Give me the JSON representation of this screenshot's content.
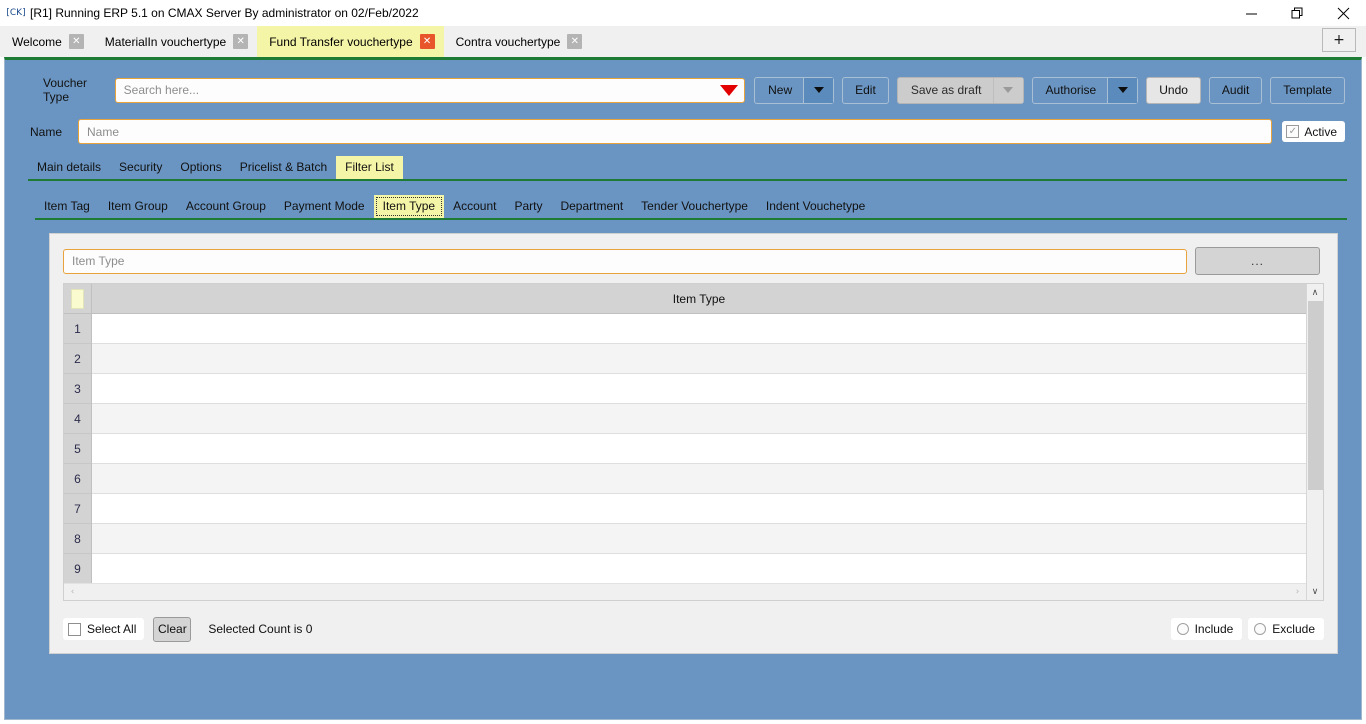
{
  "window": {
    "title": "[R1] Running ERP 5.1 on CMAX Server By administrator on 02/Feb/2022",
    "app_icon": "[CK]",
    "minimize_label": "—",
    "restore_label": "❐",
    "close_label": "✕"
  },
  "tabs": {
    "items": [
      {
        "label": "Welcome",
        "close": "✕",
        "active": false
      },
      {
        "label": "MaterialIn vouchertype",
        "close": "✕",
        "active": false
      },
      {
        "label": "Fund Transfer vouchertype",
        "close": "✕",
        "active": true
      },
      {
        "label": "Contra vouchertype",
        "close": "✕",
        "active": false
      }
    ],
    "new_tab_label": "+"
  },
  "toolbar": {
    "voucher_type_label": "Voucher Type",
    "search_placeholder": "Search here...",
    "buttons": {
      "new": "New",
      "edit": "Edit",
      "save_as_draft": "Save as draft",
      "authorise": "Authorise",
      "undo": "Undo",
      "audit": "Audit",
      "template": "Template"
    }
  },
  "name_row": {
    "label": "Name",
    "placeholder": "Name",
    "active_label": "Active",
    "active_checked_glyph": "✓"
  },
  "main_tabs": {
    "items": [
      {
        "label": "Main details",
        "active": false
      },
      {
        "label": "Security",
        "active": false
      },
      {
        "label": "Options",
        "active": false
      },
      {
        "label": "Pricelist & Batch",
        "active": false
      },
      {
        "label": "Filter List",
        "active": true
      }
    ]
  },
  "sub_tabs": {
    "items": [
      {
        "label": "Item Tag",
        "active": false
      },
      {
        "label": "Item Group",
        "active": false
      },
      {
        "label": "Account Group",
        "active": false
      },
      {
        "label": "Payment Mode",
        "active": false
      },
      {
        "label": "Item Type",
        "active": true
      },
      {
        "label": "Account",
        "active": false
      },
      {
        "label": "Party",
        "active": false
      },
      {
        "label": "Department",
        "active": false
      },
      {
        "label": "Tender Vouchertype",
        "active": false
      },
      {
        "label": "Indent Vouchetype",
        "active": false
      }
    ]
  },
  "filter_panel": {
    "input_placeholder": "Item Type",
    "browse_button_label": "..."
  },
  "grid": {
    "column_header": "Item Type",
    "rows": [
      {
        "num": "1",
        "value": ""
      },
      {
        "num": "2",
        "value": ""
      },
      {
        "num": "3",
        "value": ""
      },
      {
        "num": "4",
        "value": ""
      },
      {
        "num": "5",
        "value": ""
      },
      {
        "num": "6",
        "value": ""
      },
      {
        "num": "7",
        "value": ""
      },
      {
        "num": "8",
        "value": ""
      },
      {
        "num": "9",
        "value": ""
      }
    ],
    "scroll_up_glyph": "∧",
    "scroll_down_glyph": "∨",
    "scroll_left_glyph": "‹",
    "scroll_right_glyph": "›"
  },
  "bottom_bar": {
    "select_all_label": "Select All",
    "clear_label": "Clear",
    "selected_count_label": "Selected Count is 0",
    "include_label": "Include",
    "exclude_label": "Exclude"
  },
  "colors": {
    "panel_blue": "#6a95c2",
    "accent_green": "#1e7b34",
    "active_tab_yellow": "#f5f5a8",
    "input_border_orange": "#e8a33d",
    "close_active_red": "#e8552b"
  }
}
